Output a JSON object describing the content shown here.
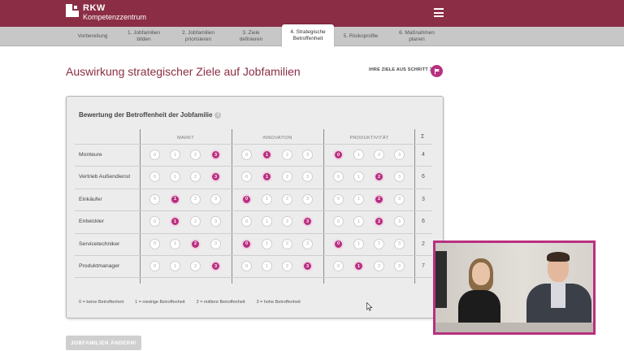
{
  "header": {
    "logo_line1": "RKW",
    "logo_line2": "Kompetenzzentrum"
  },
  "steps": [
    {
      "line1": "Vorbereitung",
      "line2": ""
    },
    {
      "line1": "1. Jobfamilien",
      "line2": "bilden"
    },
    {
      "line1": "2. Jobfamilien",
      "line2": "priorisieren"
    },
    {
      "line1": "3. Ziele",
      "line2": "definieren"
    },
    {
      "line1": "4. Strategische",
      "line2": "Betroffenheit"
    },
    {
      "line1": "5. Risikoprofile",
      "line2": ""
    },
    {
      "line1": "6. Maßnahmen",
      "line2": "planen"
    }
  ],
  "active_step_index": 4,
  "page": {
    "title": "Auswirkung strategischer Ziele auf Jobfamilien",
    "goals_link": "IHRE ZIELE AUS SCHRITT 3",
    "change_button": "JOBFAMILIEN ÄNDERN!"
  },
  "panel": {
    "title": "Bewertung der Betroffenheit der Jobfamilie",
    "info_symbol": "i",
    "columns": [
      "MARKT",
      "INNOVATION",
      "PRODUKTIVITÄT"
    ],
    "sum_header": "Σ",
    "scale": [
      "0",
      "1",
      "2",
      "3"
    ],
    "rows": [
      {
        "label": "Monteure",
        "values": [
          3,
          1,
          0
        ],
        "sum": "4"
      },
      {
        "label": "Vertrieb Außendienst",
        "values": [
          3,
          1,
          2
        ],
        "sum": "6"
      },
      {
        "label": "Einkäufer",
        "values": [
          1,
          0,
          2
        ],
        "sum": "3"
      },
      {
        "label": "Entwickler",
        "values": [
          1,
          3,
          2
        ],
        "sum": "6"
      },
      {
        "label": "Servicetechniker",
        "values": [
          2,
          0,
          0
        ],
        "sum": "2"
      },
      {
        "label": "Produktmanager",
        "values": [
          3,
          3,
          1
        ],
        "sum": "7"
      }
    ],
    "legend": [
      "0 = keine Betroffenheit",
      "1 = niedrige Betroffenheit",
      "2 = mittlere Betroffenheit",
      "3 = hohe Betroffenheit"
    ]
  },
  "colors": {
    "brand": "#8b2e45",
    "accent": "#b8307f"
  }
}
